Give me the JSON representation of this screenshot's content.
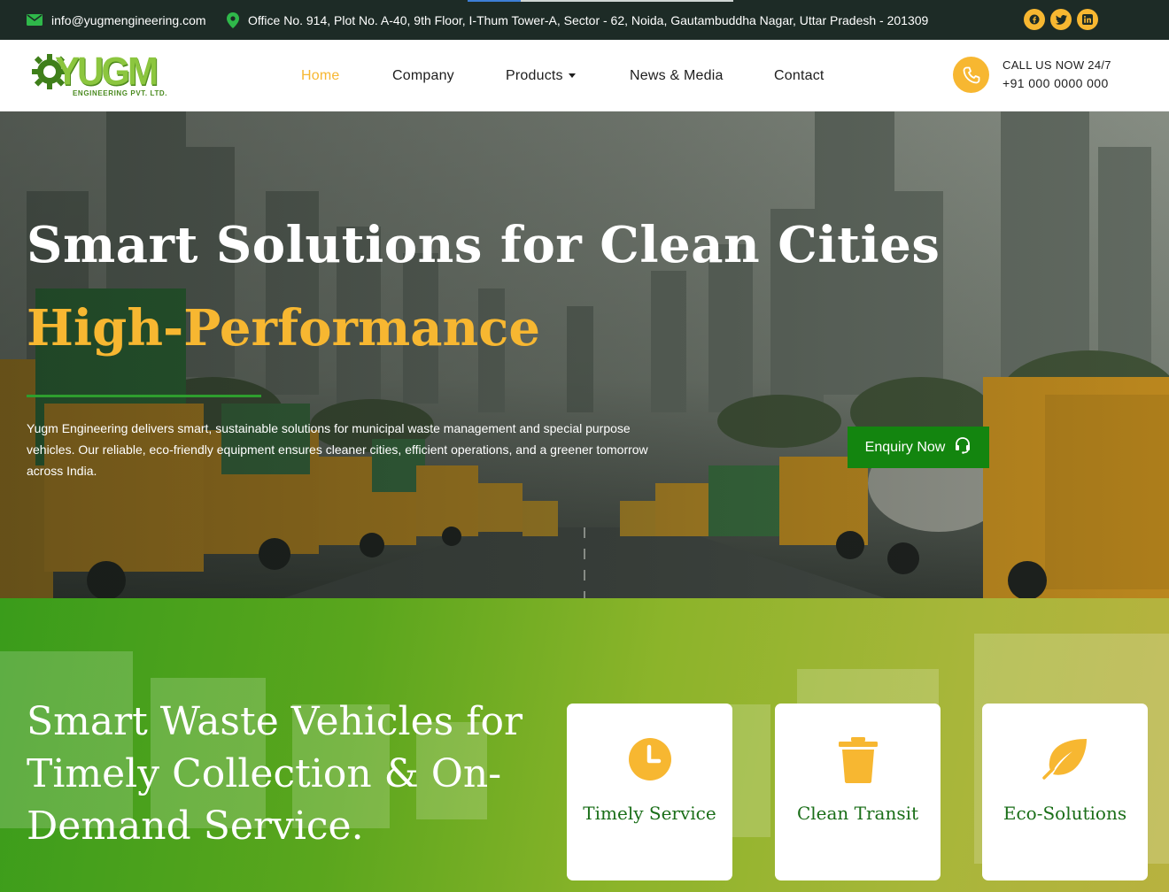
{
  "topbar": {
    "email": "info@yugmengineering.com",
    "address": "Office No. 914, Plot No. A-40, 9th Floor, I-Thum Tower-A, Sector - 62, Noida, Gautambuddha Nagar, Uttar Pradesh - 201309",
    "social": [
      "facebook-icon",
      "twitter-icon",
      "linkedin-icon"
    ]
  },
  "header": {
    "logo_text": "YUGM",
    "logo_sub": "ENGINEERING PVT. LTD.",
    "nav": [
      {
        "label": "Home",
        "active": true
      },
      {
        "label": "Company"
      },
      {
        "label": "Products"
      },
      {
        "label": "News & Media"
      },
      {
        "label": "Contact"
      }
    ],
    "call_label": "CALL US NOW 24/7",
    "call_number": "+91 000 0000 000"
  },
  "hero": {
    "title": "Smart Solutions for Clean Cities",
    "subtitle": "High-Performance",
    "description": "Yugm Engineering delivers smart, sustainable solutions for municipal waste management and special purpose vehicles. Our reliable, eco-friendly equipment ensures cleaner cities, efficient operations, and a greener tomorrow across India.",
    "cta": "Enquiry Now"
  },
  "features": {
    "heading": "Smart Waste Vehicles for Timely Collection & On-Demand Service.",
    "cards": [
      {
        "title": "Timely Service",
        "icon": "clock-icon"
      },
      {
        "title": "Clean Transit",
        "icon": "trash-icon"
      },
      {
        "title": "Eco-Solutions",
        "icon": "leaf-icon"
      }
    ]
  },
  "colors": {
    "accent": "#f7b731",
    "green": "#13850f",
    "topbar": "#1d2b26"
  }
}
